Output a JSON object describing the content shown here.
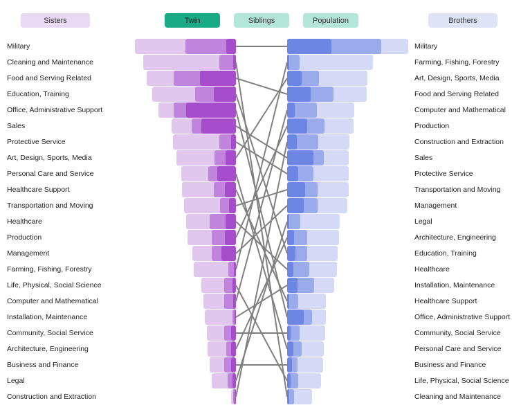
{
  "legend": {
    "sisters": {
      "label": "Sisters",
      "color": "#ead9f4"
    },
    "twin": {
      "label": "Twin",
      "color": "#1aab85",
      "active": true
    },
    "siblings": {
      "label": "Siblings",
      "color": "#b3e5d8"
    },
    "population": {
      "label": "Population",
      "color": "#b3e5d8"
    },
    "brothers": {
      "label": "Brothers",
      "color": "#dfe3f8"
    }
  },
  "colors": {
    "sisters_population": "#e1c6ee",
    "sisters_siblings": "#c184dc",
    "sisters_twin": "#a64dcb",
    "brothers_twin": "#6e86e3",
    "brothers_siblings": "#9aabec",
    "brothers_population": "#d4daf6",
    "connector": "#808080"
  },
  "chart_data": {
    "type": "bar",
    "subtype": "mirrored stacked ranking with slope connectors",
    "units": "relative share (estimated, arbitrary units; Population bar = total)",
    "layers": [
      "Population",
      "Siblings",
      "Twin"
    ],
    "sisters": {
      "title": "Sisters",
      "categories": [
        "Military",
        "Cleaning and Maintenance",
        "Food and Serving Related",
        "Education, Training",
        "Office, Administrative Support",
        "Sales",
        "Protective Service",
        "Art, Design, Sports, Media",
        "Personal Care and Service",
        "Healthcare Support",
        "Transportation and Moving",
        "Healthcare",
        "Production",
        "Management",
        "Farming, Fishing, Forestry",
        "Life, Physical, Social Science",
        "Computer and Mathematical",
        "Installation, Maintenance",
        "Community, Social Service",
        "Architecture, Engineering",
        "Business and Finance",
        "Legal",
        "Construction and Extraction"
      ],
      "series": [
        {
          "name": "Population",
          "values": [
            146,
            134,
            129,
            121,
            112,
            93,
            91,
            86,
            79,
            78,
            75,
            72,
            70,
            63,
            61,
            50,
            47,
            45,
            42,
            41,
            38,
            35,
            7
          ]
        },
        {
          "name": "Siblings",
          "values": [
            73,
            24,
            90,
            59,
            90,
            64,
            24,
            31,
            40,
            32,
            23,
            38,
            35,
            35,
            11,
            17,
            17,
            5,
            17,
            14,
            17,
            12,
            4
          ]
        },
        {
          "name": "Twin",
          "values": [
            14,
            4,
            52,
            32,
            72,
            50,
            7,
            15,
            27,
            16,
            10,
            15,
            16,
            21,
            3,
            5,
            4,
            2,
            7,
            7,
            7,
            5,
            2
          ]
        }
      ]
    },
    "brothers": {
      "title": "Brothers",
      "categories": [
        "Military",
        "Farming, Fishing, Forestry",
        "Art, Design, Sports, Media",
        "Food and Serving Related",
        "Computer and Mathematical",
        "Production",
        "Construction and Extraction",
        "Sales",
        "Protective Service",
        "Transportation and Moving",
        "Management",
        "Legal",
        "Architecture, Engineering",
        "Education, Training",
        "Healthcare",
        "Installation, Maintenance",
        "Healthcare Support",
        "Office, Administrative Support",
        "Community, Social Service",
        "Personal Care and Service",
        "Business and Finance",
        "Life, Physical, Social Science",
        "Cleaning and Maintenance"
      ],
      "series": [
        {
          "name": "Population",
          "values": [
            175,
            124,
            116,
            115,
            97,
            96,
            90,
            89,
            89,
            89,
            87,
            76,
            75,
            73,
            72,
            68,
            56,
            56,
            55,
            53,
            52,
            49,
            36
          ]
        },
        {
          "name": "Siblings",
          "values": [
            136,
            18,
            46,
            67,
            43,
            54,
            45,
            53,
            38,
            44,
            44,
            19,
            29,
            29,
            32,
            39,
            16,
            36,
            18,
            21,
            15,
            16,
            10
          ]
        },
        {
          "name": "Twin",
          "values": [
            64,
            3,
            21,
            34,
            11,
            29,
            14,
            38,
            16,
            26,
            24,
            3,
            10,
            12,
            9,
            15,
            3,
            24,
            5,
            9,
            7,
            5,
            3
          ]
        }
      ]
    },
    "connectors": "each occupation's rank in Sisters list is linked by a line to its rank in Brothers list"
  }
}
